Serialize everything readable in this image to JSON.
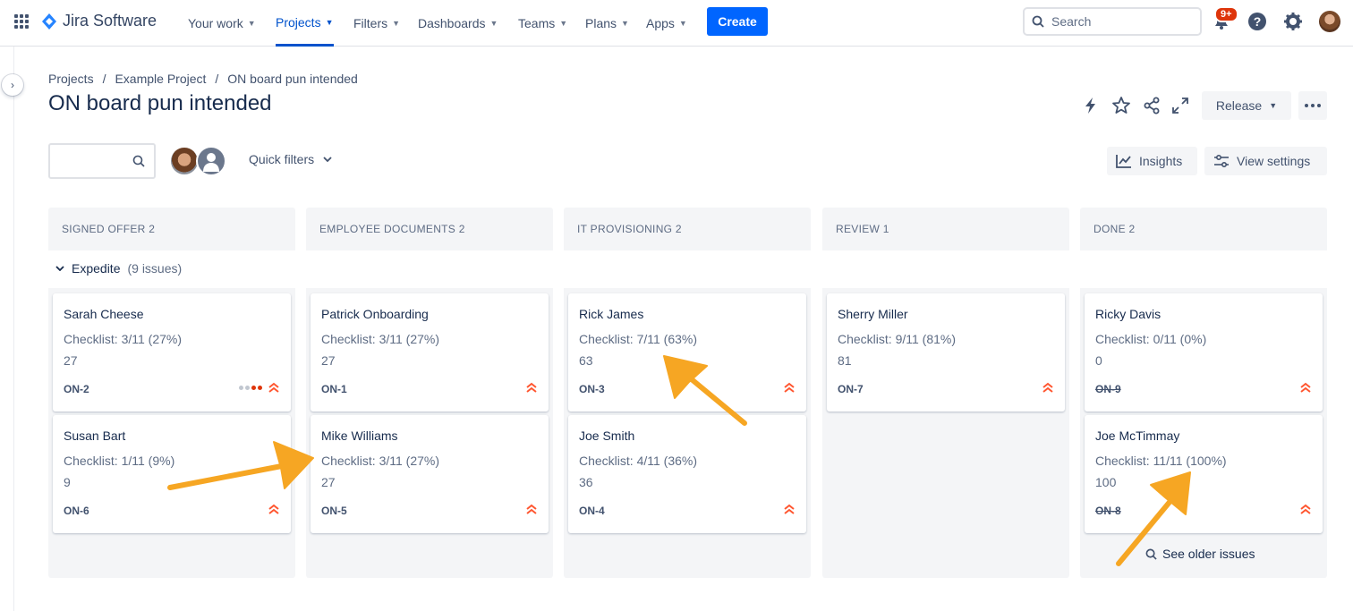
{
  "topnav": {
    "product": "Jira Software",
    "items": [
      {
        "label": "Your work",
        "active": false
      },
      {
        "label": "Projects",
        "active": true
      },
      {
        "label": "Filters",
        "active": false
      },
      {
        "label": "Dashboards",
        "active": false
      },
      {
        "label": "Teams",
        "active": false
      },
      {
        "label": "Plans",
        "active": false
      },
      {
        "label": "Apps",
        "active": false
      }
    ],
    "create_label": "Create",
    "search_placeholder": "Search",
    "notification_badge": "9+"
  },
  "breadcrumb": [
    "Projects",
    "/",
    "Example Project",
    "/",
    "ON board pun intended"
  ],
  "page_title": "ON board pun intended",
  "header_actions": {
    "release_label": "Release"
  },
  "toolbar": {
    "quick_filters_label": "Quick filters",
    "insights_label": "Insights",
    "view_settings_label": "View settings"
  },
  "columns": [
    {
      "title": "SIGNED OFFER 2"
    },
    {
      "title": "EMPLOYEE DOCUMENTS 2"
    },
    {
      "title": "IT PROVISIONING 2"
    },
    {
      "title": "REVIEW 1"
    },
    {
      "title": "DONE 2"
    }
  ],
  "swimlane": {
    "name": "Expedite",
    "count": "(9 issues)"
  },
  "cards": [
    {
      "name": "Sarah Cheese",
      "checklist": "Checklist: 3/11 (27%)",
      "value": "27",
      "key": "ON-2"
    },
    {
      "name": "Susan Bart",
      "checklist": "Checklist: 1/11 (9%)",
      "value": "9",
      "key": "ON-6"
    },
    {
      "name": "Patrick Onboarding",
      "checklist": "Checklist: 3/11 (27%)",
      "value": "27",
      "key": "ON-1"
    },
    {
      "name": "Mike Williams",
      "checklist": "Checklist: 3/11 (27%)",
      "value": "27",
      "key": "ON-5"
    },
    {
      "name": "Rick James",
      "checklist": "Checklist: 7/11 (63%)",
      "value": "63",
      "key": "ON-3"
    },
    {
      "name": "Joe Smith",
      "checklist": "Checklist: 4/11 (36%)",
      "value": "36",
      "key": "ON-4"
    },
    {
      "name": "Sherry Miller",
      "checklist": "Checklist: 9/11 (81%)",
      "value": "81",
      "key": "ON-7"
    },
    {
      "name": "Ricky Davis",
      "checklist": "Checklist: 0/11 (0%)",
      "value": "0",
      "key": "ON-9"
    },
    {
      "name": "Joe McTimmay",
      "checklist": "Checklist: 11/11 (100%)",
      "value": "100",
      "key": "ON-8"
    }
  ],
  "see_older_label": "See older issues",
  "colors": {
    "accent": "#0052CC",
    "create": "#0065FF",
    "priority": "#FF5630",
    "annotation_arrow": "#F6A623"
  }
}
